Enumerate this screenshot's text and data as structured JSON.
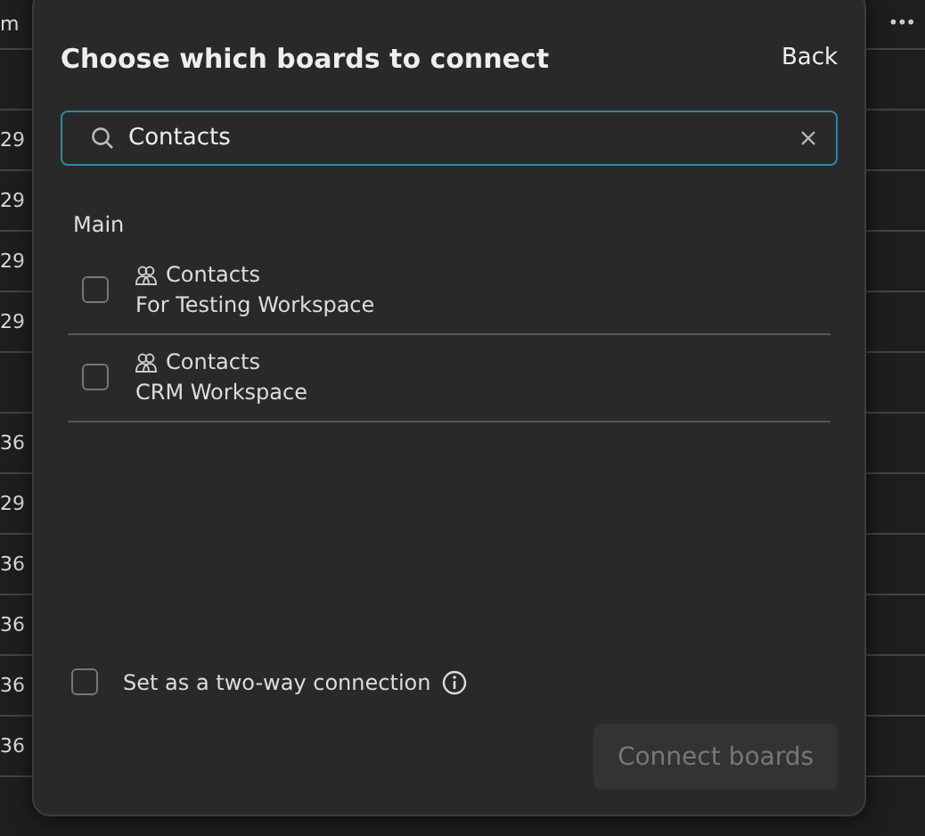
{
  "background_table": {
    "header_cell": "m",
    "more_button": "•••",
    "rows": [
      "",
      "29",
      "29",
      "29",
      "29",
      "",
      "36",
      "29",
      "36",
      "36",
      "36",
      "36",
      ""
    ]
  },
  "dialog": {
    "title": "Choose which boards to connect",
    "back": "Back",
    "search": {
      "value": "Contacts"
    },
    "section": "Main",
    "boards": [
      {
        "name": "Contacts",
        "workspace": "For Testing Workspace",
        "checked": false
      },
      {
        "name": "Contacts",
        "workspace": "CRM Workspace",
        "checked": false
      }
    ],
    "two_way": {
      "label": "Set as a two-way connection",
      "checked": false
    },
    "connect_button": {
      "label": "Connect boards",
      "disabled": true
    }
  }
}
